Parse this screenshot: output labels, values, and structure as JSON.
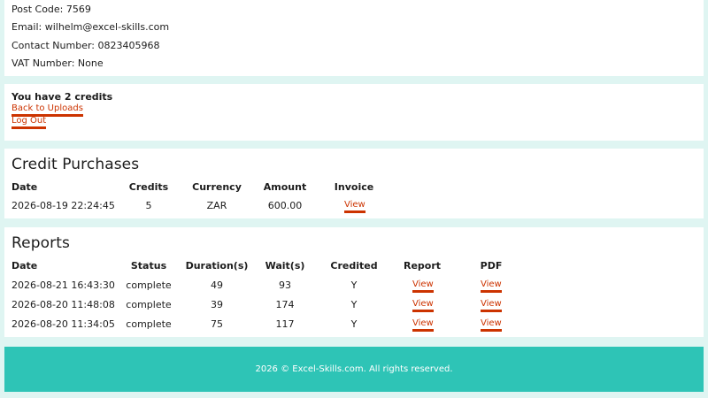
{
  "profile": {
    "post_code": "Post Code: 7569",
    "email": "Email: wilhelm@excel-skills.com",
    "contact": "Contact Number: 0823405968",
    "vat": "VAT Number: None"
  },
  "credits": {
    "text": "You have 2 credits",
    "back_link": "Back to Uploads",
    "logout_link": "Log Out"
  },
  "purchases": {
    "title": "Credit Purchases",
    "headers": [
      "Date",
      "Credits",
      "Currency",
      "Amount",
      "Invoice"
    ],
    "rows": [
      {
        "date": "2026-08-19 22:24:45",
        "credits": "5",
        "currency": "ZAR",
        "amount": "600.00",
        "invoice": "View"
      }
    ]
  },
  "reports": {
    "title": "Reports",
    "headers": [
      "Date",
      "Status",
      "Duration(s)",
      "Wait(s)",
      "Credited",
      "Report",
      "PDF"
    ],
    "rows": [
      {
        "date": "2026-08-21 16:43:30",
        "status": "complete",
        "duration": "49",
        "wait": "93",
        "credited": "Y",
        "report": "View",
        "pdf": "View"
      },
      {
        "date": "2026-08-20 11:48:08",
        "status": "complete",
        "duration": "39",
        "wait": "174",
        "credited": "Y",
        "report": "View",
        "pdf": "View"
      },
      {
        "date": "2026-08-20 11:34:05",
        "status": "complete",
        "duration": "75",
        "wait": "117",
        "credited": "Y",
        "report": "View",
        "pdf": "View"
      }
    ]
  },
  "footer": {
    "text": "2026 © Excel-Skills.com. All rights reserved."
  },
  "colors": {
    "accent": "#cc3300",
    "footer_bg": "#2ec4b6",
    "page_bg": "#dff5f2"
  }
}
